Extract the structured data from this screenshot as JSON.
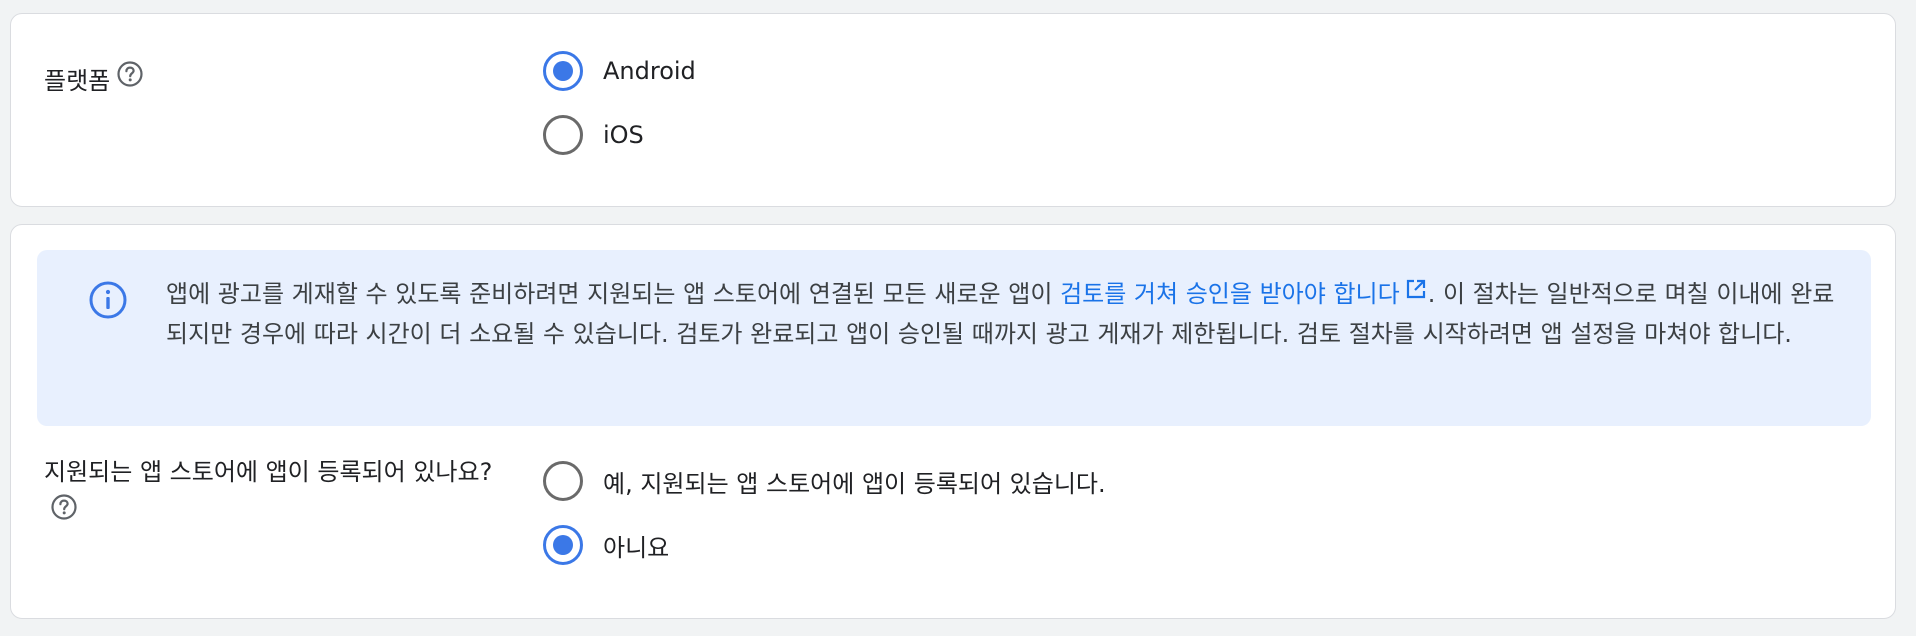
{
  "platform": {
    "label": "플랫폼",
    "help_icon": "help-circle-icon",
    "options": [
      {
        "label": "Android",
        "selected": true
      },
      {
        "label": "iOS",
        "selected": false
      }
    ]
  },
  "info_banner": {
    "icon": "info-icon",
    "text_before_link": "앱에 광고를 게재할 수 있도록 준비하려면 지원되는 앱 스토어에 연결된 모든 새로운 앱이 ",
    "link_text": "검토를 거쳐 승인을 받아야 합니다",
    "link_icon": "open-in-new-icon",
    "text_after_link": ". 이 절차는 일반적으로 며칠 이내에 완료되지만 경우에 따라 시간이 더 소요될 수 있습니다. 검토가 완료되고 앱이 승인될 때까지 광고 게재가 제한됩니다. 검토 절차를 시작하려면 앱 설정을 마쳐야 합니다."
  },
  "store_listing": {
    "label": "지원되는 앱 스토어에 앱이 등록되어 있나요?",
    "help_icon": "help-circle-icon",
    "options": [
      {
        "label": "예, 지원되는 앱 스토어에 앱이 등록되어 있습니다.",
        "selected": false
      },
      {
        "label": "아니요",
        "selected": true
      }
    ]
  },
  "colors": {
    "accent": "#3b78e7",
    "link": "#1a73e8",
    "info_background": "#e8f0fe",
    "card_border": "#dadce0"
  }
}
